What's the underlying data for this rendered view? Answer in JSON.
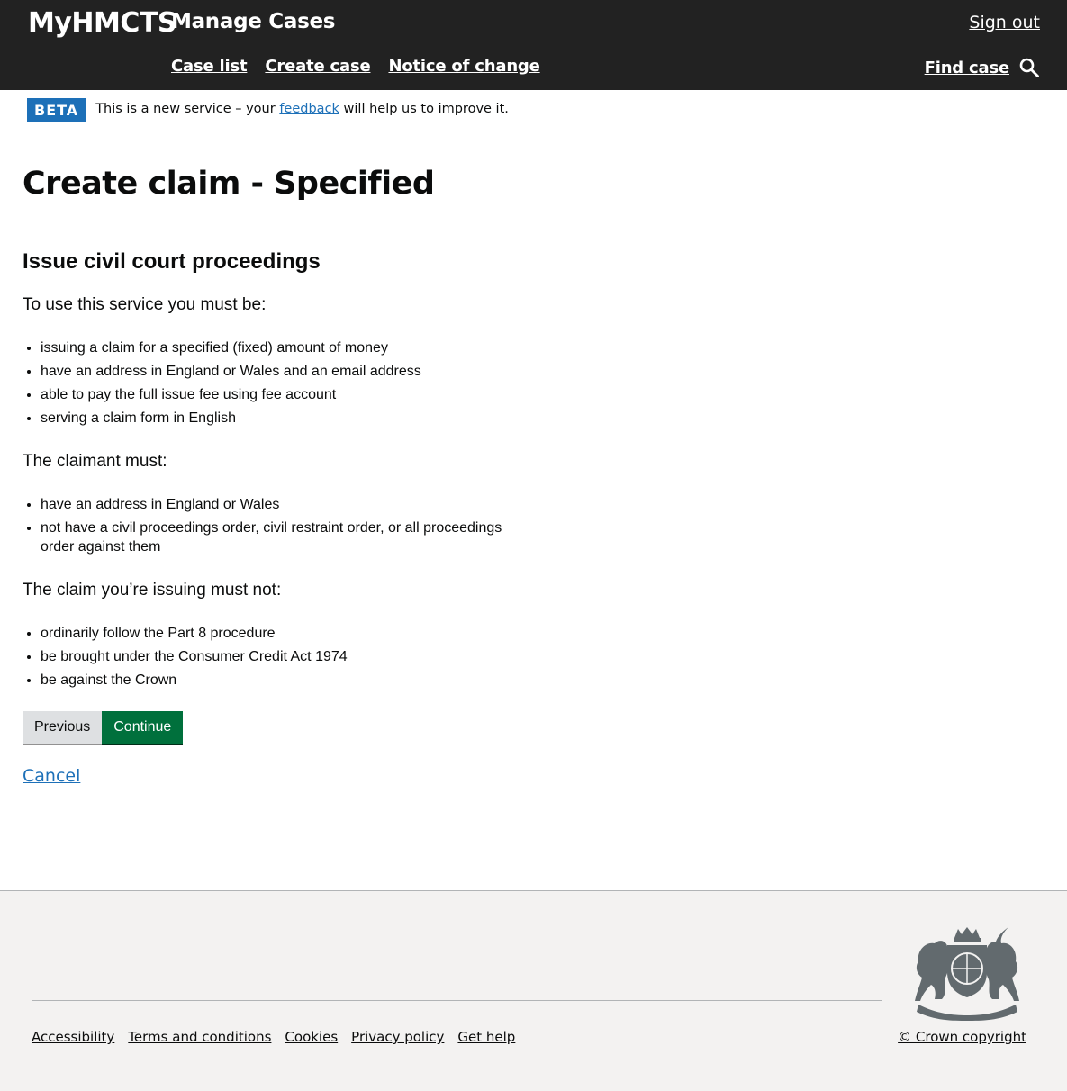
{
  "header": {
    "brand": "MyHMCTS",
    "service_name": "Manage Cases",
    "sign_out": "Sign out",
    "nav": [
      "Case list",
      "Create case",
      "Notice of change"
    ],
    "find_case": "Find case"
  },
  "phase_banner": {
    "tag": "BETA",
    "text_before": "This is a new service – your",
    "link": "feedback",
    "text_after": "will help us to improve it."
  },
  "main": {
    "title": "Create claim - Specified",
    "heading": "Issue civil court proceedings",
    "intro": "To use this service you must be:",
    "list1": [
      "issuing a claim for a specified (fixed) amount of money",
      "have an address in England or Wales and an email address",
      "able to pay the full issue fee using fee account",
      "serving a claim form in English"
    ],
    "claimant_intro": "The claimant must:",
    "list2": [
      "have an address in England or Wales",
      "not have a civil proceedings order, civil restraint order, or all proceedings order against them"
    ],
    "claim_intro": "The claim you’re issuing must not:",
    "list3": [
      "ordinarily follow the Part 8 procedure",
      "be brought under the Consumer Credit Act 1974",
      "be against the Crown"
    ],
    "previous_label": "Previous",
    "continue_label": "Continue",
    "cancel_label": "Cancel"
  },
  "footer": {
    "links": [
      "Accessibility",
      "Terms and conditions",
      "Cookies",
      "Privacy policy",
      "Get help"
    ],
    "copyright": "© Crown copyright"
  },
  "colors": {
    "header_bg": "#222222",
    "link": "#1d70b8",
    "tag_bg": "#1d70b8",
    "continue_bg": "#00703c",
    "previous_bg": "#dee0e2",
    "footer_bg": "#f3f2f1"
  },
  "icons": {
    "search": "search-icon",
    "crest": "royal-coat-of-arms-icon"
  }
}
